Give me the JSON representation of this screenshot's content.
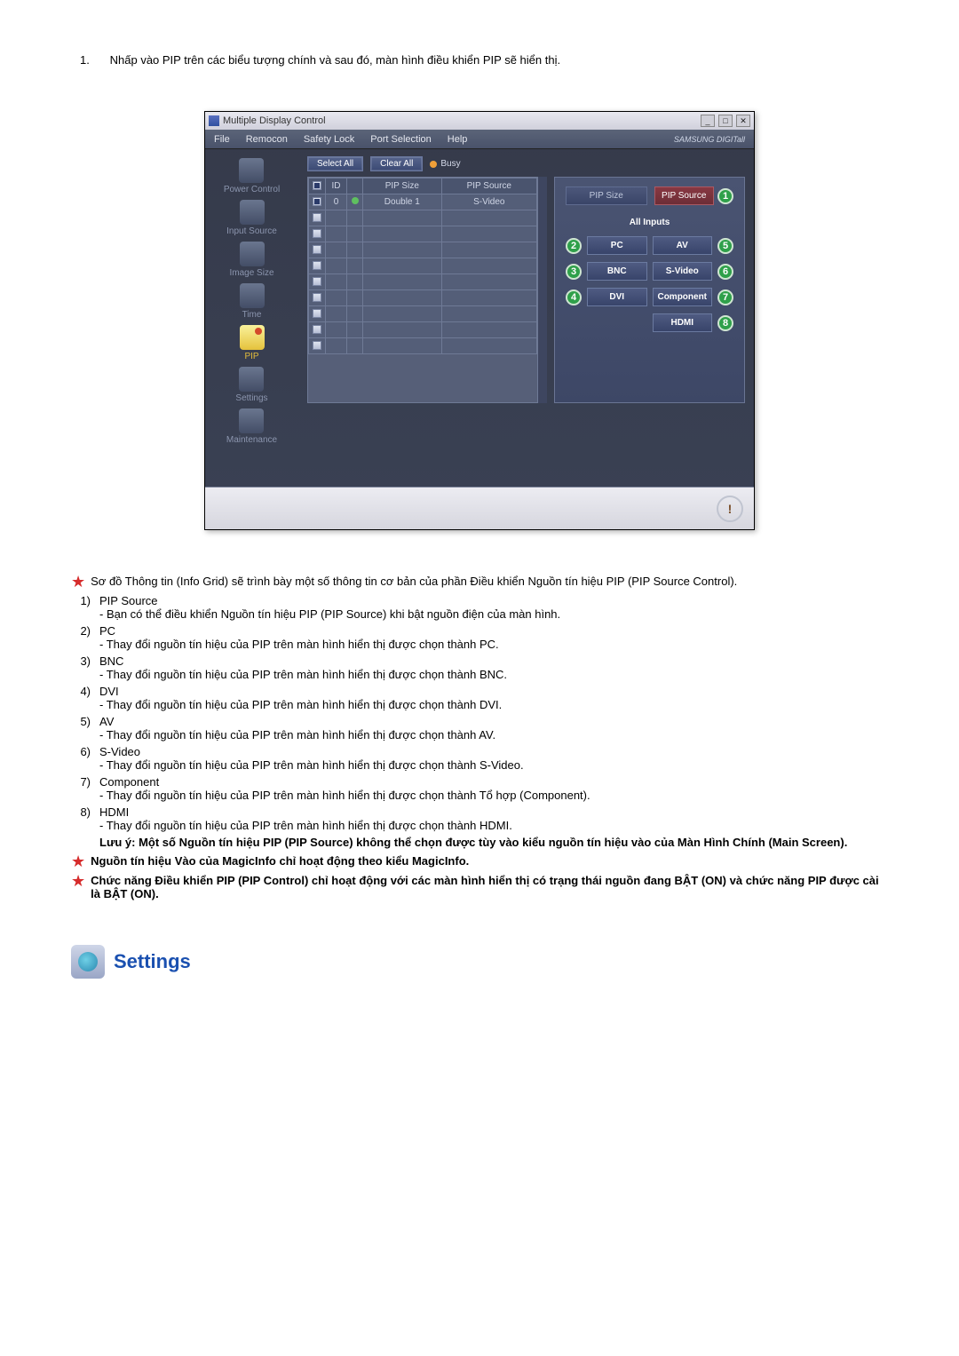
{
  "intro": {
    "num": "1.",
    "text": "Nhấp vào PIP trên các biểu tượng chính và sau đó, màn hình điều khiển PIP sẽ hiển thị."
  },
  "app": {
    "title": "Multiple Display Control",
    "menu": {
      "file": "File",
      "remocon": "Remocon",
      "safety_lock": "Safety Lock",
      "port_selection": "Port Selection",
      "help": "Help",
      "brand": "SAMSUNG DIGITall"
    },
    "sidebar": {
      "items": [
        {
          "label": "Power Control"
        },
        {
          "label": "Input Source"
        },
        {
          "label": "Image Size"
        },
        {
          "label": "Time"
        },
        {
          "label": "PIP"
        },
        {
          "label": "Settings"
        },
        {
          "label": "Maintenance"
        }
      ]
    },
    "toolbar": {
      "select_all": "Select All",
      "clear_all": "Clear All",
      "busy": "Busy"
    },
    "grid": {
      "headers": {
        "chk": "",
        "id": "ID",
        "status": "",
        "pip_size": "PIP Size",
        "pip_source": "PIP Source"
      },
      "rows": [
        {
          "checked": true,
          "id": "0",
          "status": "on",
          "pip_size": "Double 1",
          "pip_source": "S-Video"
        },
        {
          "checked": false,
          "id": "",
          "status": "",
          "pip_size": "",
          "pip_source": ""
        },
        {
          "checked": false,
          "id": "",
          "status": "",
          "pip_size": "",
          "pip_source": ""
        },
        {
          "checked": false,
          "id": "",
          "status": "",
          "pip_size": "",
          "pip_source": ""
        },
        {
          "checked": false,
          "id": "",
          "status": "",
          "pip_size": "",
          "pip_source": ""
        },
        {
          "checked": false,
          "id": "",
          "status": "",
          "pip_size": "",
          "pip_source": ""
        },
        {
          "checked": false,
          "id": "",
          "status": "",
          "pip_size": "",
          "pip_source": ""
        },
        {
          "checked": false,
          "id": "",
          "status": "",
          "pip_size": "",
          "pip_source": ""
        },
        {
          "checked": false,
          "id": "",
          "status": "",
          "pip_size": "",
          "pip_source": ""
        },
        {
          "checked": false,
          "id": "",
          "status": "",
          "pip_size": "",
          "pip_source": ""
        }
      ]
    },
    "panel": {
      "tabs": {
        "pip_size": "PIP Size",
        "pip_source": "PIP Source"
      },
      "all_inputs": "All Inputs",
      "buttons": {
        "pc": "PC",
        "av": "AV",
        "bnc": "BNC",
        "svideo": "S-Video",
        "dvi": "DVI",
        "component": "Component",
        "hdmi": "HDMI"
      },
      "marks": {
        "m1": "1",
        "m2": "2",
        "m3": "3",
        "m4": "4",
        "m5": "5",
        "m6": "6",
        "m7": "7",
        "m8": "8"
      }
    },
    "bottom_icon": "!"
  },
  "notes": {
    "star1": "Sơ đồ Thông tin (Info Grid) sẽ trình bày một số thông tin cơ bản của phần Điều khiển Nguồn tín hiệu PIP (PIP Source Control).",
    "items": [
      {
        "n": "1)",
        "title": "PIP Source",
        "desc": "- Bạn có thể điều khiển Nguồn tín hiệu PIP (PIP Source) khi bật nguồn điện của màn hình."
      },
      {
        "n": "2)",
        "title": "PC",
        "desc": "- Thay đổi nguồn tín hiệu của PIP trên màn hình hiển thị được chọn thành PC."
      },
      {
        "n": "3)",
        "title": "BNC",
        "desc": "- Thay đổi nguồn tín hiệu của PIP trên màn hình hiển thị được chọn thành BNC."
      },
      {
        "n": "4)",
        "title": "DVI",
        "desc": "- Thay đổi nguồn tín hiệu của PIP trên màn hình hiển thị được chọn thành DVI."
      },
      {
        "n": "5)",
        "title": "AV",
        "desc": "- Thay đổi nguồn tín hiệu của PIP trên màn hình hiển thị được chọn thành AV."
      },
      {
        "n": "6)",
        "title": "S-Video",
        "desc": "- Thay đổi nguồn tín hiệu của PIP trên màn hình hiển thị được chọn thành S-Video."
      },
      {
        "n": "7)",
        "title": "Component",
        "desc": "- Thay đổi nguồn tín hiệu của PIP trên màn hình hiển thị được chọn thành Tổ hợp (Component)."
      },
      {
        "n": "8)",
        "title": "HDMI",
        "desc": "- Thay đổi nguồn tín hiệu của PIP trên màn hình hiển thị được chọn thành HDMI."
      }
    ],
    "warning": "Lưu ý: Một số Nguồn tín hiệu PIP (PIP Source) không thể chọn được tùy vào kiểu nguồn tín hiệu vào của Màn Hình Chính (Main Screen).",
    "star2": "Nguồn tín hiệu Vào của MagicInfo chỉ hoạt động theo kiểu MagicInfo.",
    "star3": "Chức năng Điều khiển PIP (PIP Control) chỉ hoạt động với các màn hình hiển thị có trạng thái nguồn đang BẬT (ON) và chức năng PIP được cài là BẬT (ON)."
  },
  "section_heading": "Settings"
}
